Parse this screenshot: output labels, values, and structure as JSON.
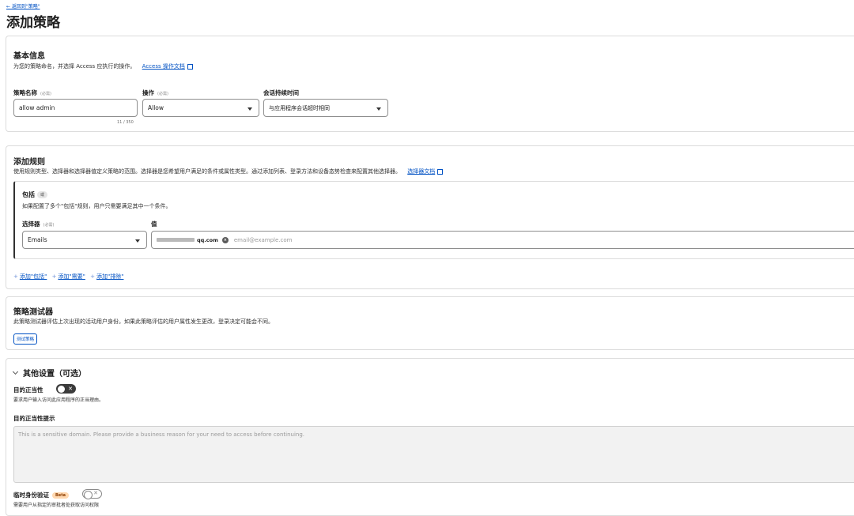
{
  "header": {
    "back_link": "← 返回到\"策略\"",
    "title": "添加策略"
  },
  "basic": {
    "title": "基本信息",
    "desc": "为您的策略命名，并选择 Access 应执行的操作。",
    "doc_link": "Access 操作文档",
    "name_label": "策略名称",
    "required": "(必需)",
    "name_value": "allow admin",
    "name_counter": "11 / 350",
    "action_label": "操作",
    "action_value": "Allow",
    "session_label": "会话持续时间",
    "session_value": "与应用程序会话超时相同"
  },
  "rules": {
    "title": "添加规则",
    "desc": "使用规则类型、选择器和选择器值定义策略的范围。选择器是您希望用户满足的条件或属性类型。通过添加列表、登录方法和设备态势检查来配置其他选择器。",
    "doc_link": "选择器文档",
    "include": {
      "title": "包括",
      "badge": "或",
      "desc": "如果配置了多个\"包括\"规则，用户只需要满足其中一个条件。",
      "selector_label": "选择器",
      "selector_required": "(必需)",
      "selector_value": "Emails",
      "value_label": "值",
      "chip_suffix": "qq.com",
      "chip_remove": "×",
      "value_placeholder": "email@example.com"
    },
    "add_include": "添加\"包括\"",
    "add_require": "添加\"需要\"",
    "add_exclude": "添加\"排除\"",
    "plus": "+"
  },
  "tester": {
    "title": "策略测试器",
    "desc": "此策略测试器评估上次出现的活动用户身份。如果此策略评估的用户属性发生更改，登录决定可能会不同。",
    "button": "测试策略"
  },
  "other": {
    "title": "其他设置（可选）",
    "purpose_label": "目的正当性",
    "purpose_toggle_mark": "✕",
    "purpose_desc": "要求用户输入访问此应用程序的正当理由。",
    "prompt_label": "目的正当性提示",
    "prompt_placeholder": "This is a sensitive domain. Please provide a business reason for your need to access before continuing.",
    "temp_label": "临时身份验证",
    "beta": "Beta",
    "temp_toggle_mark": "✕",
    "temp_desc": "需要用户从指定的审批者处获取访问权限"
  },
  "colors": {
    "link": "#0051c3",
    "beta_bg": "#ffd8b0"
  }
}
